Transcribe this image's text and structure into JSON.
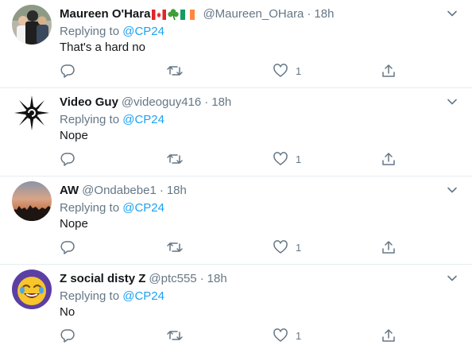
{
  "tweets": [
    {
      "name": "Maureen O'Hara",
      "flags": [
        "canada-flag-icon",
        "shamrock-icon",
        "ireland-flag-icon"
      ],
      "handle": "@Maureen_OHara",
      "dot": "·",
      "time": "18h",
      "replying_prefix": "Replying to ",
      "replying_to": "@CP24",
      "text": "That's a hard no",
      "likes": "1"
    },
    {
      "name": "Video Guy",
      "handle": "@videoguy416",
      "dot": "·",
      "time": "18h",
      "replying_prefix": "Replying to ",
      "replying_to": "@CP24",
      "text": "Nope",
      "likes": "1"
    },
    {
      "name": "AW",
      "handle": "@Ondabebe1",
      "dot": "·",
      "time": "18h",
      "replying_prefix": "Replying to ",
      "replying_to": "@CP24",
      "text": "Nope",
      "likes": "1"
    },
    {
      "name": "Z social disty Z",
      "handle": "@ptc555",
      "dot": "·",
      "time": "18h",
      "replying_prefix": "Replying to ",
      "replying_to": "@CP24",
      "text": "No",
      "likes": "1"
    }
  ],
  "colors": {
    "text": "#14171a",
    "secondary": "#657786",
    "link": "#1da1f2",
    "divider": "#e6ecf0"
  },
  "icons": {
    "reply": "reply-icon",
    "retweet": "retweet-icon",
    "like": "heart-icon",
    "share": "share-icon",
    "more": "chevron-down-icon"
  }
}
